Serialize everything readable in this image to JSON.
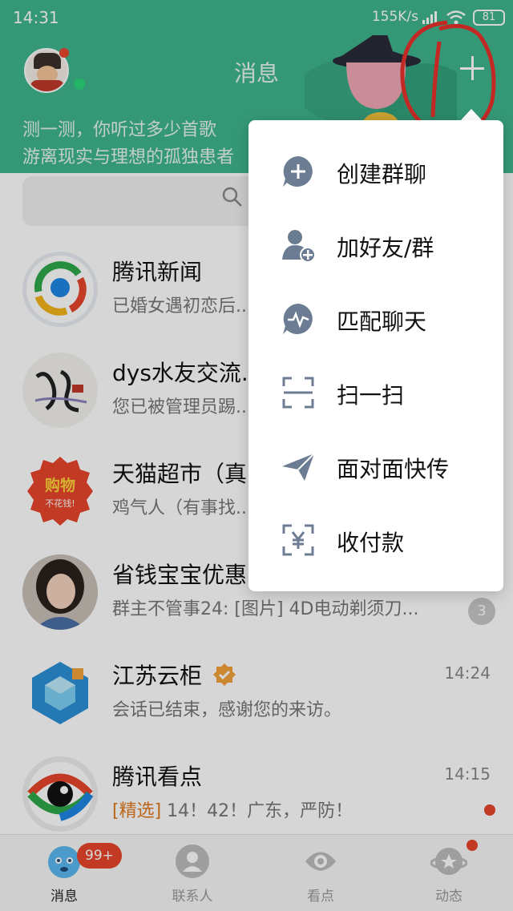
{
  "status_bar": {
    "time": "14:31",
    "net_speed": "155K/s",
    "battery": "81"
  },
  "header": {
    "title": "消息",
    "banner_line1": "测一测，你听过多少首歌",
    "banner_line2": "游离现实与理想的孤独患者"
  },
  "conversations": [
    {
      "name": "腾讯新闻",
      "preview": "已婚女遇初恋后...",
      "time": ""
    },
    {
      "name": "dys水友交流...",
      "preview": "您已被管理员踢...",
      "time": ""
    },
    {
      "name": "天猫超市（真...",
      "preview": "鸡气人（有事找...",
      "time": ""
    },
    {
      "name": "省钱宝宝优惠...",
      "preview": "群主不管事24: [图片] 4D电动剃须刀...",
      "time": "",
      "unread": "3"
    },
    {
      "name": "江苏云柜",
      "preview": "会话已结束，感谢您的来访。",
      "time": "14:24"
    },
    {
      "name": "腾讯看点",
      "preview_tag": "[精选]",
      "preview": " 14！42！广东，严防！",
      "time": "14:15"
    }
  ],
  "avatar_labels": {
    "tmall_top": "购物",
    "tmall_bottom": "不花钱!"
  },
  "menu": {
    "items": [
      {
        "label": "创建群聊",
        "icon": "create-group-icon"
      },
      {
        "label": "加好友/群",
        "icon": "add-friend-icon"
      },
      {
        "label": "匹配聊天",
        "icon": "match-chat-icon"
      },
      {
        "label": "扫一扫",
        "icon": "scan-icon"
      },
      {
        "label": "面对面快传",
        "icon": "transfer-icon"
      },
      {
        "label": "收付款",
        "icon": "payment-icon"
      }
    ]
  },
  "tabs": [
    {
      "label": "消息",
      "badge": "99+",
      "active": true
    },
    {
      "label": "联系人"
    },
    {
      "label": "看点"
    },
    {
      "label": "动态"
    }
  ],
  "colors": {
    "brand": "#3fb58d",
    "accent_red": "#e8452c",
    "menu_icon": "#6b7c93"
  }
}
